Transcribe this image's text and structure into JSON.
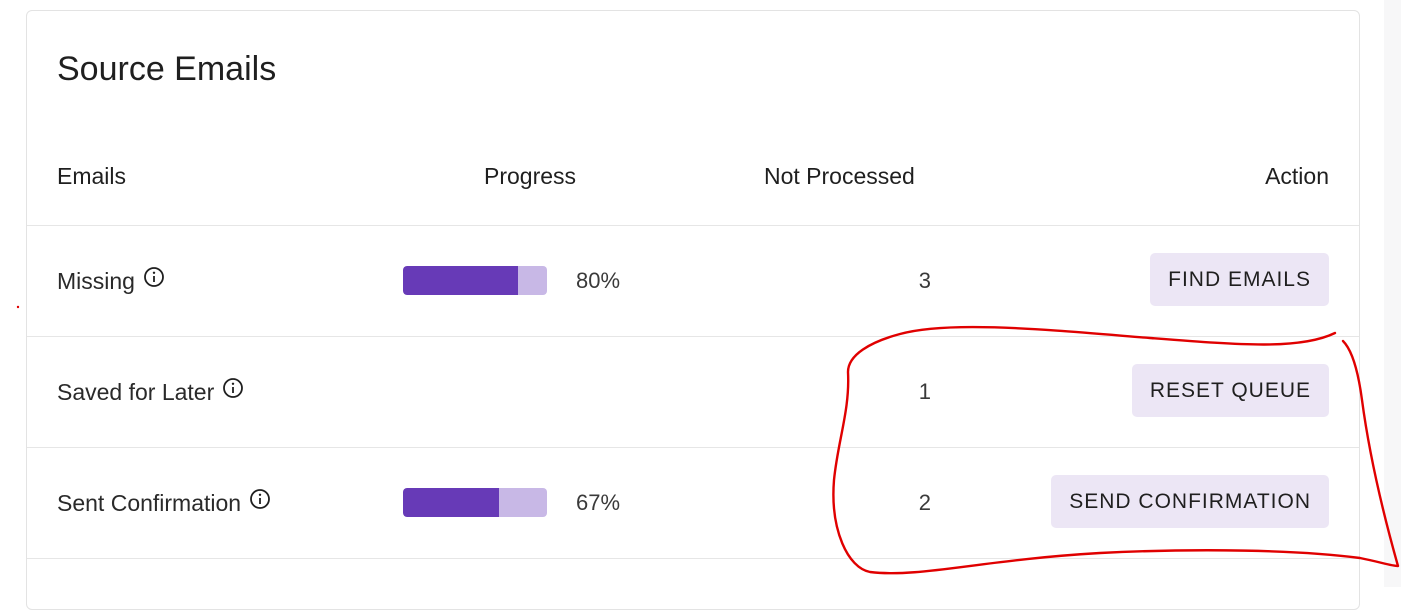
{
  "card": {
    "title": "Source Emails"
  },
  "table": {
    "headers": {
      "emails": "Emails",
      "progress": "Progress",
      "not_processed": "Not Processed",
      "action": "Action"
    },
    "rows": [
      {
        "label": "Missing",
        "has_progress": true,
        "progress_value": 0.8,
        "progress_text": "80%",
        "count": "3",
        "action_label": "FIND EMAILS"
      },
      {
        "label": "Saved for Later",
        "has_progress": false,
        "count": "1",
        "action_label": "RESET QUEUE"
      },
      {
        "label": "Sent Confirmation",
        "has_progress": true,
        "progress_value": 0.67,
        "progress_text": "67%",
        "count": "2",
        "action_label": "SEND CONFIRMATION"
      }
    ]
  },
  "icons": {
    "row_info": "info-icon"
  },
  "colors": {
    "progress_fill": "#673ab7",
    "progress_track": "#c8b8e6",
    "button_bg": "#ece6f5",
    "annotation_stroke": "#e00000"
  }
}
